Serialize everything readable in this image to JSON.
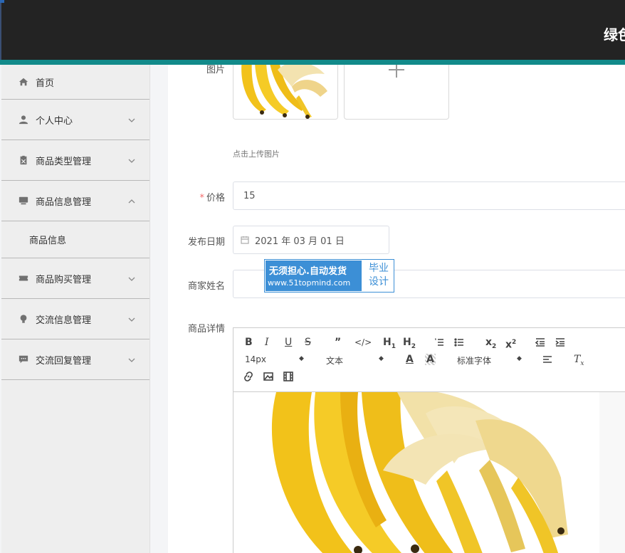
{
  "header": {
    "title": "绿色"
  },
  "sidebar": {
    "items": [
      {
        "label": "首页",
        "icon": "home-icon",
        "expanded": null
      },
      {
        "label": "个人中心",
        "icon": "user-icon",
        "expanded": false
      },
      {
        "label": "商品类型管理",
        "icon": "clipboard-icon",
        "expanded": false
      },
      {
        "label": "商品信息管理",
        "icon": "monitor-icon",
        "expanded": true
      },
      {
        "label": "商品购买管理",
        "icon": "ticket-icon",
        "expanded": false
      },
      {
        "label": "交流信息管理",
        "icon": "bulb-icon",
        "expanded": false
      },
      {
        "label": "交流回复管理",
        "icon": "chat-icon",
        "expanded": false
      }
    ],
    "sub_item": "商品信息"
  },
  "form": {
    "image_label": "图片",
    "upload_tip": "点击上传图片",
    "price_label": "价格",
    "price_value": "15",
    "date_label": "发布日期",
    "date_value": "2021 年 03 月 01 日",
    "merchant_label": "商家姓名",
    "detail_label": "商品详情"
  },
  "editor": {
    "font_size": "14px",
    "text_style": "文本",
    "font_family": "标准字体"
  },
  "watermark": {
    "line1": "无须担心.自动发货",
    "line2": "www.51topmind.com",
    "right1": "毕业",
    "right2": "设计"
  },
  "colors": {
    "teal": "#128a8a",
    "topbar": "#232323",
    "required": "#f56c6c",
    "watermark": "#3c8fd6"
  }
}
